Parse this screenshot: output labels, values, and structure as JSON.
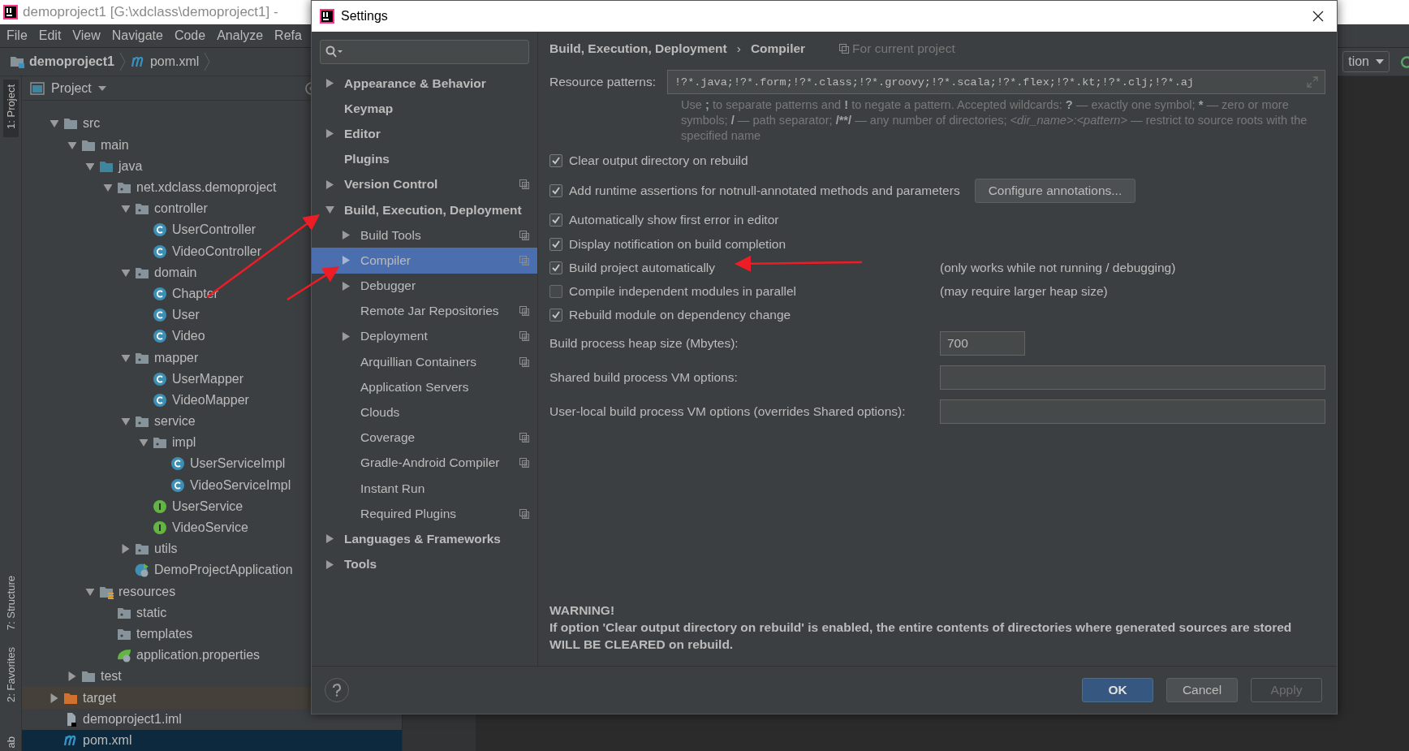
{
  "ide": {
    "title": "demoproject1 [G:\\xdclass\\demoproject1] -",
    "menu": [
      "File",
      "Edit",
      "View",
      "Navigate",
      "Code",
      "Analyze",
      "Refa"
    ],
    "breadcrumb": {
      "project": "demoproject1",
      "file": "pom.xml"
    },
    "tool_stripe": [
      {
        "label": "1: Project",
        "selected": true
      },
      {
        "label": "7: Structure",
        "selected": false
      },
      {
        "label": "2: Favorites",
        "selected": false
      },
      {
        "label": "ab",
        "selected": false
      }
    ],
    "project_panel": {
      "title": "Project",
      "tree": [
        {
          "label": "src",
          "kind": "folder",
          "expanded": true,
          "selected": false,
          "children": [
            {
              "label": "main",
              "kind": "folder",
              "expanded": true,
              "selected": false,
              "children": [
                {
                  "label": "java",
                  "kind": "source-folder",
                  "expanded": true,
                  "selected": false,
                  "children": [
                    {
                      "label": "net.xdclass.demoproject",
                      "kind": "package",
                      "expanded": true,
                      "selected": false,
                      "children": [
                        {
                          "label": "controller",
                          "kind": "package",
                          "expanded": true,
                          "selected": false,
                          "children": [
                            {
                              "label": "UserController",
                              "kind": "class",
                              "selected": false
                            },
                            {
                              "label": "VideoController",
                              "kind": "class",
                              "selected": false
                            }
                          ]
                        },
                        {
                          "label": "domain",
                          "kind": "package",
                          "expanded": true,
                          "selected": false,
                          "children": [
                            {
                              "label": "Chapter",
                              "kind": "class",
                              "selected": false
                            },
                            {
                              "label": "User",
                              "kind": "class",
                              "selected": false
                            },
                            {
                              "label": "Video",
                              "kind": "class",
                              "selected": false
                            }
                          ]
                        },
                        {
                          "label": "mapper",
                          "kind": "package",
                          "expanded": true,
                          "selected": false,
                          "children": [
                            {
                              "label": "UserMapper",
                              "kind": "class",
                              "selected": false
                            },
                            {
                              "label": "VideoMapper",
                              "kind": "class",
                              "selected": false
                            }
                          ]
                        },
                        {
                          "label": "service",
                          "kind": "package",
                          "expanded": true,
                          "selected": false,
                          "children": [
                            {
                              "label": "impl",
                              "kind": "package",
                              "expanded": true,
                              "selected": false,
                              "children": [
                                {
                                  "label": "UserServiceImpl",
                                  "kind": "class",
                                  "selected": false
                                },
                                {
                                  "label": "VideoServiceImpl",
                                  "kind": "class",
                                  "selected": false
                                }
                              ]
                            },
                            {
                              "label": "UserService",
                              "kind": "interface",
                              "selected": false
                            },
                            {
                              "label": "VideoService",
                              "kind": "interface",
                              "selected": false
                            }
                          ]
                        },
                        {
                          "label": "utils",
                          "kind": "package",
                          "expanded": false,
                          "selected": false
                        },
                        {
                          "label": "DemoProjectApplication",
                          "kind": "spring-app",
                          "selected": false
                        }
                      ]
                    }
                  ]
                },
                {
                  "label": "resources",
                  "kind": "resources",
                  "expanded": true,
                  "selected": false,
                  "children": [
                    {
                      "label": "static",
                      "kind": "package",
                      "selected": false
                    },
                    {
                      "label": "templates",
                      "kind": "package",
                      "selected": false
                    },
                    {
                      "label": "application.properties",
                      "kind": "properties",
                      "selected": false
                    }
                  ]
                }
              ]
            },
            {
              "label": "test",
              "kind": "folder",
              "expanded": false,
              "selected": false
            }
          ]
        },
        {
          "label": "target",
          "kind": "excluded-folder",
          "expanded": false,
          "selected": false
        },
        {
          "label": "demoproject1.iml",
          "kind": "iml",
          "selected": false
        },
        {
          "label": "pom.xml",
          "kind": "maven",
          "selected": true
        }
      ]
    },
    "toolbar": {
      "run_config": "tion"
    }
  },
  "settings": {
    "title": "Settings",
    "tree": [
      {
        "label": "Appearance & Behavior",
        "expanded": false,
        "selected": false
      },
      {
        "label": "Keymap",
        "selected": false
      },
      {
        "label": "Editor",
        "expanded": false,
        "selected": false
      },
      {
        "label": "Plugins",
        "selected": false
      },
      {
        "label": "Version Control",
        "expanded": false,
        "selected": false,
        "project_scope": true
      },
      {
        "label": "Build, Execution, Deployment",
        "expanded": true,
        "selected": false,
        "children": [
          {
            "label": "Build Tools",
            "expanded": false,
            "selected": false,
            "project_scope": true
          },
          {
            "label": "Compiler",
            "expanded": false,
            "selected": true,
            "project_scope": true
          },
          {
            "label": "Debugger",
            "expanded": false,
            "selected": false
          },
          {
            "label": "Remote Jar Repositories",
            "selected": false,
            "project_scope": true
          },
          {
            "label": "Deployment",
            "expanded": false,
            "selected": false,
            "project_scope": true
          },
          {
            "label": "Arquillian Containers",
            "selected": false,
            "project_scope": true
          },
          {
            "label": "Application Servers",
            "selected": false
          },
          {
            "label": "Clouds",
            "selected": false
          },
          {
            "label": "Coverage",
            "selected": false,
            "project_scope": true
          },
          {
            "label": "Gradle-Android Compiler",
            "selected": false,
            "project_scope": true
          },
          {
            "label": "Instant Run",
            "selected": false
          },
          {
            "label": "Required Plugins",
            "selected": false,
            "project_scope": true
          }
        ]
      },
      {
        "label": "Languages & Frameworks",
        "expanded": false,
        "selected": false
      },
      {
        "label": "Tools",
        "expanded": false,
        "selected": false
      }
    ],
    "header": {
      "path": "Build, Execution, Deployment",
      "separator": "›",
      "current": "Compiler",
      "scope_note": "For current project"
    },
    "resource_patterns": {
      "label": "Resource patterns:",
      "value": "!?*.java;!?*.form;!?*.class;!?*.groovy;!?*.scala;!?*.flex;!?*.kt;!?*.clj;!?*.aj"
    },
    "hint": [
      {
        "text": "Use ",
        "kind": "plain"
      },
      {
        "text": ";",
        "kind": "bold"
      },
      {
        "text": " to separate patterns and ",
        "kind": "plain"
      },
      {
        "text": "!",
        "kind": "bold"
      },
      {
        "text": " to negate a pattern. Accepted wildcards: ",
        "kind": "plain"
      },
      {
        "text": "?",
        "kind": "bold"
      },
      {
        "text": " — exactly one symbol; ",
        "kind": "plain"
      },
      {
        "text": "*",
        "kind": "bold"
      },
      {
        "text": " — zero or more symbols; ",
        "kind": "plain"
      },
      {
        "text": "/",
        "kind": "bold"
      },
      {
        "text": " — path separator; ",
        "kind": "plain"
      },
      {
        "text": "/**/",
        "kind": "bold"
      },
      {
        "text": " — any number of directories; ",
        "kind": "plain"
      },
      {
        "text": "<dir_name>:<pattern>",
        "kind": "italic"
      },
      {
        "text": " — restrict to source roots with the specified name",
        "kind": "plain"
      }
    ],
    "options": [
      {
        "label": "Clear output directory on rebuild",
        "checked": true
      },
      {
        "label": "Add runtime assertions for notnull-annotated methods and parameters",
        "checked": true,
        "button": "Configure annotations..."
      },
      {
        "label": "Automatically show first error in editor",
        "checked": true
      },
      {
        "label": "Display notification on build completion",
        "checked": true
      },
      {
        "label": "Build project automatically",
        "checked": true,
        "note": "(only works while not running / debugging)"
      },
      {
        "label": "Compile independent modules in parallel",
        "checked": false,
        "note": "(may require larger heap size)"
      },
      {
        "label": "Rebuild module on dependency change",
        "checked": true
      }
    ],
    "fields": [
      {
        "label": "Build process heap size (Mbytes):",
        "value": "700",
        "kind": "short"
      },
      {
        "label": "Shared build process VM options:",
        "kind": "wide"
      },
      {
        "label": "User-local build process VM options (overrides Shared options):",
        "kind": "wide"
      }
    ],
    "warning": {
      "title": "WARNING!",
      "body": "If option 'Clear output directory on rebuild' is enabled, the entire contents of directories where generated sources are stored WILL BE CLEARED on rebuild."
    },
    "buttons": [
      {
        "label": "OK",
        "kind": "default",
        "disabled": false
      },
      {
        "label": "Cancel",
        "kind": "normal",
        "disabled": false
      },
      {
        "label": "Apply",
        "kind": "normal",
        "disabled": true
      }
    ]
  }
}
